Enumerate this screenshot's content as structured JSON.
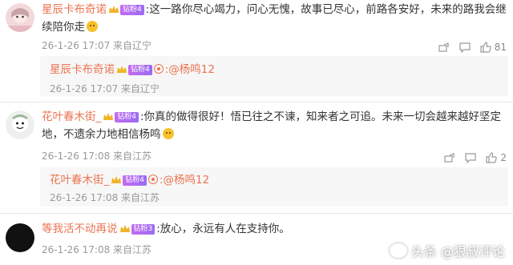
{
  "comments": [
    {
      "username": "星辰卡布奇诺",
      "badge": "钻粉4",
      "text": ":这一路你尽心竭力，问心无愧，故事已尽心，前路各安好，未来的路我会继续陪你走",
      "meta": "26-1-26 17:07 来自辽宁",
      "like_count": "81",
      "reply": {
        "username": "星辰卡布奇诺",
        "badge": "钻粉4",
        "text": ":@杨鸣12",
        "meta": "26-1-26 17:07 来自辽宁"
      }
    },
    {
      "username": "花叶春木街_",
      "badge": "钻粉4",
      "text": ":你真的做得很好！悟已往之不谏，知来者之可追。未来一切会越来越好坚定地，不遗余力地相信杨鸣",
      "meta": "26-1-26 17:08 来自江苏",
      "like_count": "2",
      "reply": {
        "username": "花叶春木街_",
        "badge": "钻粉4",
        "text": ":@杨鸣12",
        "meta": "26-1-26 17:08 来自江苏"
      }
    },
    {
      "username": "等我活不动再说",
      "badge": "钻粉3",
      "text": ":放心，永远有人在支持你。",
      "meta": "26-1-26 17:08 来自江苏"
    }
  ],
  "watermark": "头条 @狠叔评论",
  "colors": {
    "username": "#eb7350",
    "badge": "#a66cf0",
    "meta": "#999999",
    "reply_bg": "#f7f7f7"
  }
}
